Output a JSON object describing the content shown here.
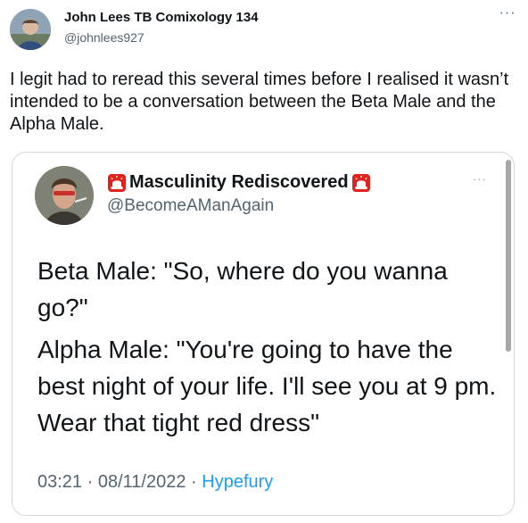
{
  "tweet": {
    "author_name": "John Lees TB Comixology 134",
    "author_handle": "@johnlees927",
    "more_label": "···",
    "text": "I legit had to reread this several times before I realised it wasn’t intended to be a conversation between the Beta Male and the Alpha Male."
  },
  "quoted": {
    "author_name": "Masculinity Rediscovered",
    "author_handle": "@BecomeAManAgain",
    "more_label": "···",
    "lines": [
      "Beta Male: \"So, where do you wanna go?\"",
      "Alpha Male: \"You're going to have the best night of your life. I'll see you at 9 pm. Wear that tight red dress\""
    ],
    "time": "03:21",
    "date": "08/11/2022",
    "separator": " · ",
    "source": "Hypefury",
    "name_icon": "siren-icon"
  },
  "colors": {
    "text": "#0f1419",
    "secondary": "#536471",
    "link": "#1d9bf0",
    "border": "#cfd9de",
    "siren": "#e0241b"
  }
}
